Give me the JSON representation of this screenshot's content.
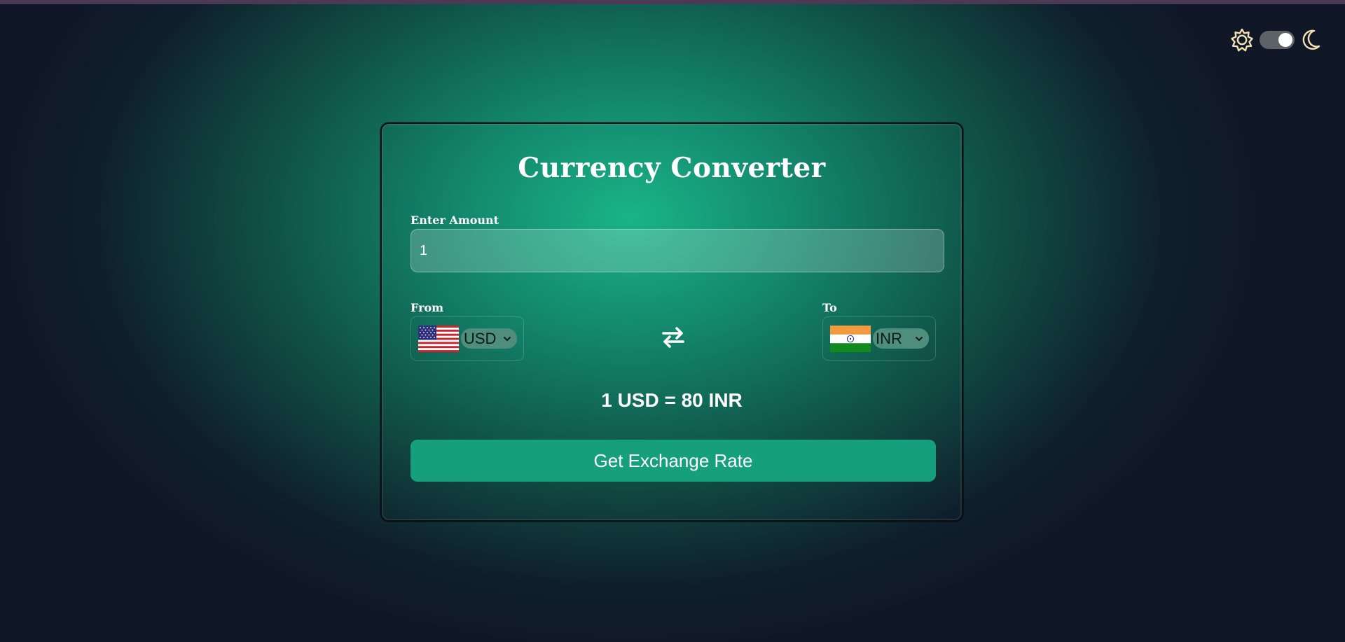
{
  "theme": {
    "light_icon": "sun-gear-icon",
    "dark_icon": "crescent-moon-icon",
    "toggle_state": "dark"
  },
  "converter": {
    "title": "Currency Converter",
    "amount_label": "Enter Amount",
    "amount_value": "1",
    "from_label": "From",
    "to_label": "To",
    "from_currency": "USD",
    "from_flag": "us-flag-icon",
    "to_currency": "INR",
    "to_flag": "india-flag-icon",
    "swap_icon": "swap-arrows-icon",
    "rate_text": "1 USD = 80 INR",
    "button_label": "Get Exchange Rate"
  },
  "colors": {
    "accent": "#169f7d",
    "background": "#101827",
    "glow": "#19b487"
  }
}
